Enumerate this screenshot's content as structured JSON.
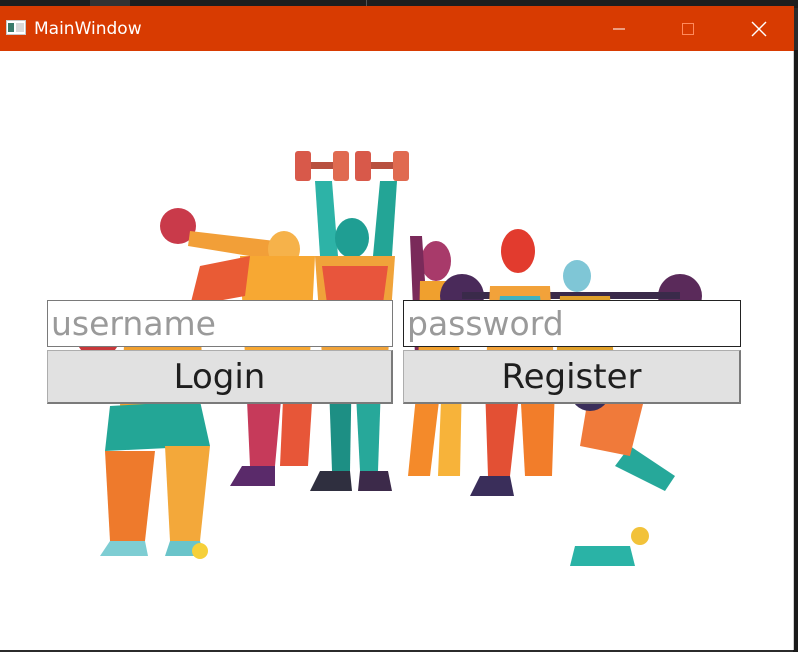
{
  "window": {
    "title": "MainWindow"
  },
  "icons": {
    "app": "app-window-icon",
    "minimize": "minimize-icon",
    "maximize": "maximize-icon",
    "close": "close-icon"
  },
  "colors": {
    "titlebar": "#d83b01",
    "window_bg": "#ffffff",
    "button_bg": "#e1e1e1",
    "placeholder_text": "#9a9a9a"
  },
  "form": {
    "username": {
      "value": "",
      "placeholder": "username"
    },
    "password": {
      "value": "",
      "placeholder": "password"
    },
    "login_label": "Login",
    "register_label": "Register"
  }
}
